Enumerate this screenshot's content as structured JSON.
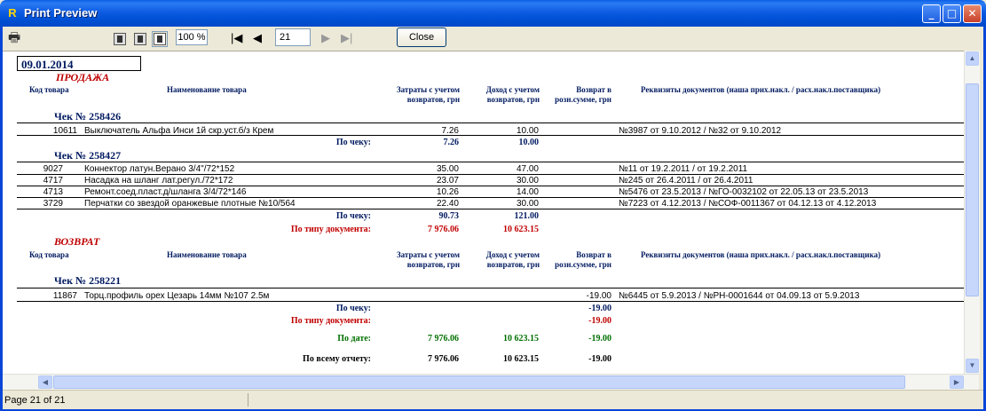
{
  "window": {
    "title": "Print Preview",
    "app_icon": "R",
    "min": "_",
    "max": "□",
    "close": "✕"
  },
  "toolbar": {
    "zoom": "100 %",
    "page": "21",
    "close_label": "Close"
  },
  "status": {
    "text": "Page 21 of 21"
  },
  "report": {
    "date": "09.01.2014",
    "headers": {
      "code": "Код товара",
      "name": "Наименование товара",
      "costs": [
        "Затраты с учетом",
        "возвратов, грн"
      ],
      "income": [
        "Доход с учетом",
        "возвратов, грн"
      ],
      "returns": [
        "Возврат в",
        "розн.сумме, грн"
      ],
      "docs": "Реквизиты документов (наша прих.накл. / расх.накл.поставщика)"
    },
    "sale": {
      "title": "ПРОДАЖА",
      "checks": [
        {
          "label": "Чек №  258426",
          "rows": [
            {
              "code": "10611",
              "name": "Выключатель Альфа Инси 1й скр.уст.б/з Крем",
              "cost": "7.26",
              "income": "10.00",
              "ret": "",
              "docs": "№3987 от 9.10.2012 / №32 от 9.10.2012"
            }
          ],
          "total_label": "По чеку:",
          "total_cost": "7.26",
          "total_income": "10.00"
        },
        {
          "label": "Чек №  258427",
          "rows": [
            {
              "code": "9027",
              "name": "Коннектор латун.Верано 3/4\"/72*152",
              "cost": "35.00",
              "income": "47.00",
              "ret": "",
              "docs": "№11 от 19.2.2011  / от 19.2.2011"
            },
            {
              "code": "4717",
              "name": "Насадка на шланг лат.регул./72*172",
              "cost": "23.07",
              "income": "30.00",
              "ret": "",
              "docs": "№245 от 26.4.2011  / от 26.4.2011"
            },
            {
              "code": "4713",
              "name": "Ремонт.соед.пласт.д/шланга 3/4/72*146",
              "cost": "10.26",
              "income": "14.00",
              "ret": "",
              "docs": "№5476 от 23.5.2013 / №ГО-0032102 от 22.05.13 от 23.5.2013"
            },
            {
              "code": "3729",
              "name": "Перчатки со звездой оранжевые плотные №10/564",
              "cost": "22.40",
              "income": "30.00",
              "ret": "",
              "docs": "№7223 от 4.12.2013 / №СОФ-0011367 от 04.12.13 от 4.12.2013"
            }
          ],
          "total_label": "По чеку:",
          "total_cost": "90.73",
          "total_income": "121.00"
        }
      ],
      "doc_total_label": "По типу документа:",
      "doc_total_cost": "7 976.06",
      "doc_total_income": "10 623.15"
    },
    "return": {
      "title": "ВОЗВРАТ",
      "checks": [
        {
          "label": "Чек №  258221",
          "rows": [
            {
              "code": "11867",
              "name": "Торц.профиль орех Цезарь 14мм №107 2.5м",
              "cost": "",
              "income": "",
              "ret": "-19.00",
              "docs": "№6445 от 5.9.2013 / №РН-0001644 от 04.09.13 от 5.9.2013"
            }
          ],
          "total_label": "По чеку:",
          "total_ret": "-19.00"
        }
      ],
      "doc_total_label": "По типу документа:",
      "doc_total_ret": "-19.00"
    },
    "by_date": {
      "label": "По дате:",
      "cost": "7 976.06",
      "income": "10 623.15",
      "ret": "-19.00"
    },
    "grand": {
      "label": "По всему отчету:",
      "cost": "7 976.06",
      "income": "10 623.15",
      "ret": "-19.00"
    }
  }
}
